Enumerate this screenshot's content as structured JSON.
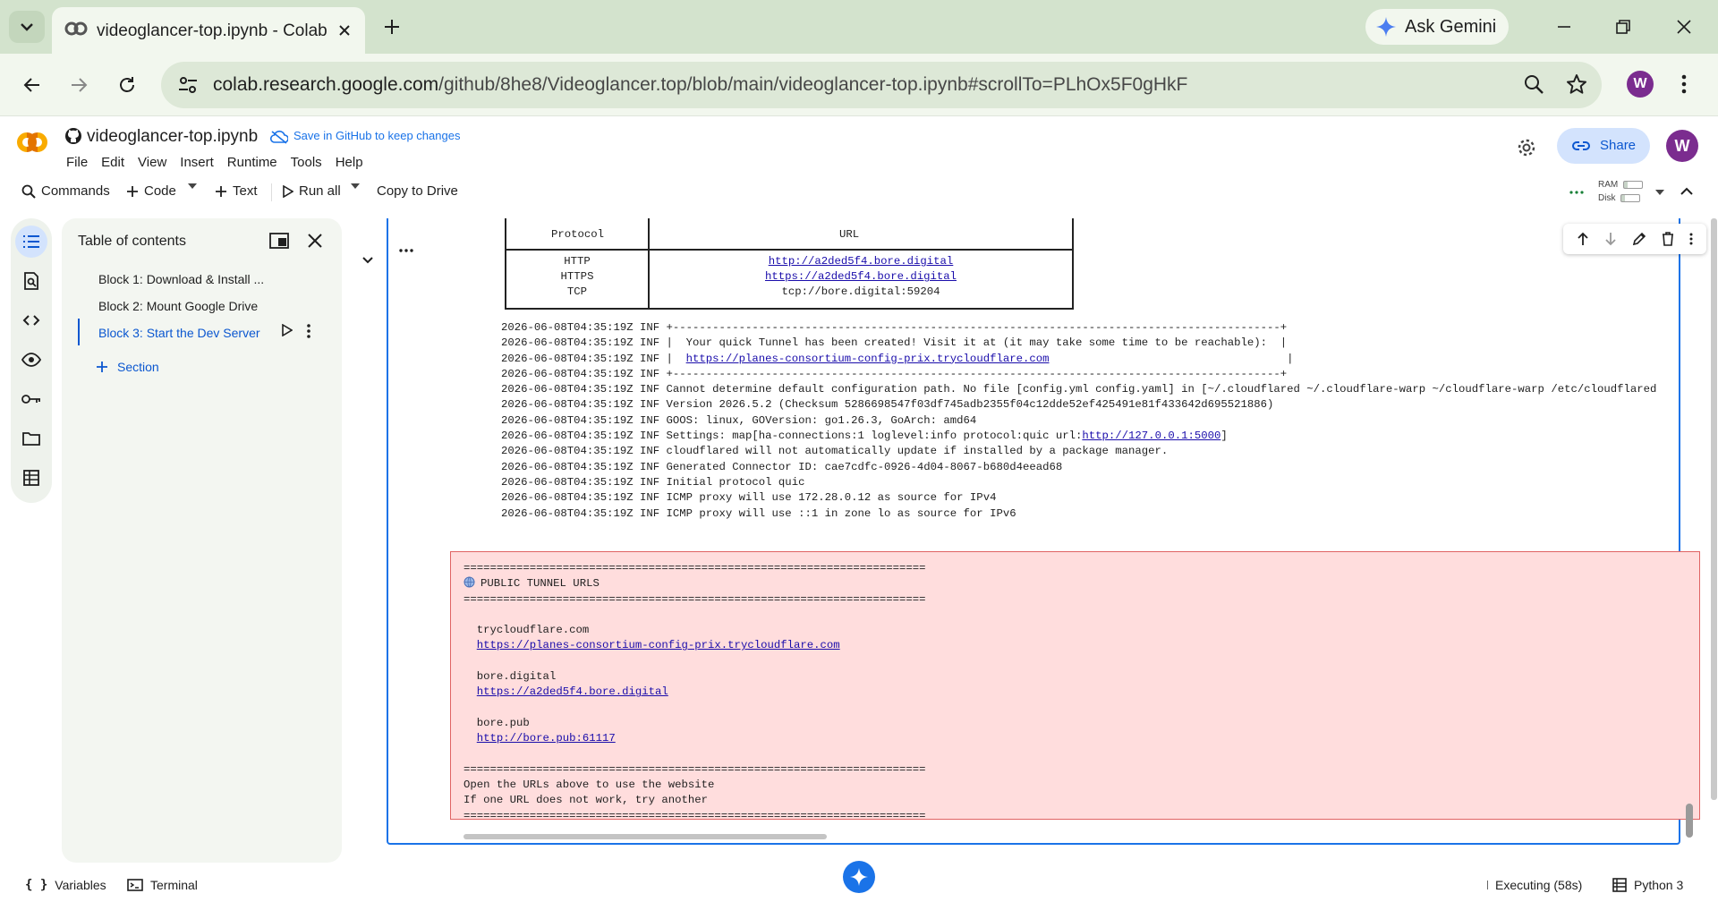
{
  "browser": {
    "tab_title": "videoglancer-top.ipynb - Colab",
    "ask_gemini": "Ask Gemini",
    "url_host": "colab.research.google.com",
    "url_path": "/github/8he8/Videoglancer.top/blob/main/videoglancer-top.ipynb#scrollTo=PLhOx5F0gHkF",
    "profile_initial": "W"
  },
  "colab": {
    "notebook_title": "videoglancer-top.ipynb",
    "save_github": "Save in GitHub to keep changes",
    "menu": [
      "File",
      "Edit",
      "View",
      "Insert",
      "Runtime",
      "Tools",
      "Help"
    ],
    "share": "Share",
    "avatar_initial": "W"
  },
  "commands": {
    "commands": "Commands",
    "code": "Code",
    "text": "Text",
    "run_all": "Run all",
    "copy_to_drive": "Copy to Drive",
    "ram": "RAM",
    "disk": "Disk"
  },
  "toc": {
    "title": "Table of contents",
    "items": [
      "Block 1: Download & Install ...",
      "Block 2: Mount Google Drive",
      "Block 3: Start the Dev Server"
    ],
    "add_section": "Section"
  },
  "output": {
    "table": {
      "protocol_header": "Protocol",
      "url_header": "URL",
      "rows": [
        {
          "protocol": "HTTP",
          "url": "http://a2ded5f4.bore.digital"
        },
        {
          "protocol": "HTTPS",
          "url": "https://a2ded5f4.bore.digital"
        },
        {
          "protocol": "TCP",
          "url": "tcp://bore.digital:59204"
        }
      ]
    },
    "log": {
      "line1": "2026-06-08T04:35:19Z INF +--------------------------------------------------------------------------------------------+",
      "line2_pre": "2026-06-08T04:35:19Z INF |  Your quick Tunnel has been created! Visit it at (it may take some time to be reachable):  |",
      "line3_pre": "2026-06-08T04:35:19Z INF |  ",
      "line3_link": "https://planes-consortium-config-prix.trycloudflare.com",
      "line3_post": "                                    |",
      "line4": "2026-06-08T04:35:19Z INF +--------------------------------------------------------------------------------------------+",
      "line5": "2026-06-08T04:35:19Z INF Cannot determine default configuration path. No file [config.yml config.yaml] in [~/.cloudflared ~/.cloudflare-warp ~/cloudflare-warp /etc/cloudflared",
      "line6": "2026-06-08T04:35:19Z INF Version 2026.5.2 (Checksum 5286698547f03df745adb2355f04c12dde52ef425491e81f433642d695521886)",
      "line7": "2026-06-08T04:35:19Z INF GOOS: linux, GOVersion: go1.26.3, GoArch: amd64",
      "line8_pre": "2026-06-08T04:35:19Z INF Settings: map[ha-connections:1 loglevel:info protocol:quic url:",
      "line8_link": "http://127.0.0.1:5000",
      "line8_post": "]",
      "line9": "2026-06-08T04:35:19Z INF cloudflared will not automatically update if installed by a package manager.",
      "line10": "2026-06-08T04:35:19Z INF Generated Connector ID: cae7cdfc-0926-4d04-8067-b680d4eead68",
      "line11": "2026-06-08T04:35:19Z INF Initial protocol quic",
      "line12": "2026-06-08T04:35:19Z INF ICMP proxy will use 172.28.0.12 as source for IPv4",
      "line13": "2026-06-08T04:35:19Z INF ICMP proxy will use ::1 in zone lo as source for IPv6"
    },
    "tunnel": {
      "rule": "======================================================================",
      "heading": "PUBLIC TUNNEL URLS",
      "entries": [
        {
          "name": "trycloudflare.com",
          "url": "https://planes-consortium-config-prix.trycloudflare.com"
        },
        {
          "name": "bore.digital",
          "url": "https://a2ded5f4.bore.digital"
        },
        {
          "name": "bore.pub",
          "url": "http://bore.pub:61117"
        }
      ],
      "note1": "Open the URLs above to use the website",
      "note2": "If one URL does not work, try another"
    }
  },
  "status": {
    "variables": "Variables",
    "terminal": "Terminal",
    "executing": "Executing (58s)",
    "runtime": "Python 3"
  },
  "colors": {
    "accent": "#1a73e8",
    "error_bg": "#ffdddd",
    "error_border": "#e06363",
    "tab_strip": "#d3e3cd"
  }
}
